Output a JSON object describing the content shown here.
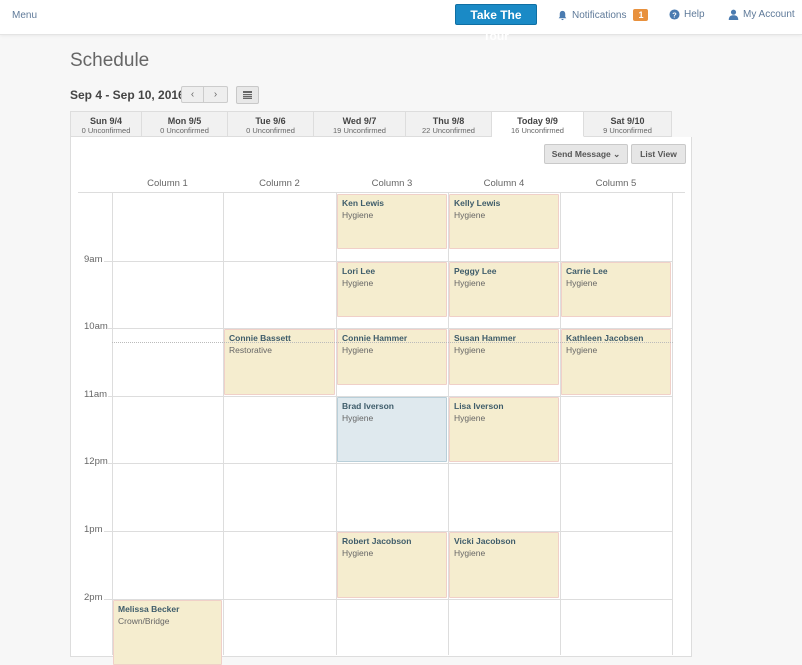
{
  "topbar": {
    "menu_label": "Menu",
    "tour_button": "Take The Tour",
    "notifications_label": "Notifications",
    "notifications_count": "1",
    "help_label": "Help",
    "account_label": "My Account",
    "colors": {
      "tour": "#1a8ac6",
      "badge": "#e8913d",
      "link": "#5f7a99"
    }
  },
  "page": {
    "title": "Schedule",
    "date_range": "Sep 4 - Sep 10, 2016",
    "prev_label": "‹",
    "next_label": "›"
  },
  "tabs": [
    {
      "day": "Sun 9/4",
      "unconfirmed": "0 Unconfirmed",
      "active": false
    },
    {
      "day": "Mon 9/5",
      "unconfirmed": "0 Unconfirmed",
      "active": false
    },
    {
      "day": "Tue 9/6",
      "unconfirmed": "0 Unconfirmed",
      "active": false
    },
    {
      "day": "Wed 9/7",
      "unconfirmed": "19 Unconfirmed",
      "active": false
    },
    {
      "day": "Thu 9/8",
      "unconfirmed": "22 Unconfirmed",
      "active": false
    },
    {
      "day": "Today 9/9",
      "unconfirmed": "16 Unconfirmed",
      "active": true
    },
    {
      "day": "Sat 9/10",
      "unconfirmed": "9 Unconfirmed",
      "active": false
    }
  ],
  "toolbar": {
    "send_message": "Send Message ⌄",
    "list_view": "List View"
  },
  "columns": [
    "Column 1",
    "Column 2",
    "Column 3",
    "Column 4",
    "Column 5"
  ],
  "times": [
    "9am",
    "10am",
    "11am",
    "12pm",
    "1pm",
    "2pm"
  ],
  "appointments": [
    {
      "name": "Ken Lewis",
      "type": "Hygiene",
      "column": 3,
      "start": 8.0,
      "end": 8.85,
      "color": "tan"
    },
    {
      "name": "Kelly Lewis",
      "type": "Hygiene",
      "column": 4,
      "start": 8.0,
      "end": 8.85,
      "color": "tan"
    },
    {
      "name": "Lori Lee",
      "type": "Hygiene",
      "column": 3,
      "start": 9.0,
      "end": 9.85,
      "color": "tan"
    },
    {
      "name": "Peggy Lee",
      "type": "Hygiene",
      "column": 4,
      "start": 9.0,
      "end": 9.85,
      "color": "tan"
    },
    {
      "name": "Carrie Lee",
      "type": "Hygiene",
      "column": 5,
      "start": 9.0,
      "end": 9.85,
      "color": "tan"
    },
    {
      "name": "Connie Bassett",
      "type": "Restorative",
      "column": 2,
      "start": 10.0,
      "end": 11.0,
      "color": "tan"
    },
    {
      "name": "Connie Hammer",
      "type": "Hygiene",
      "column": 3,
      "start": 10.0,
      "end": 10.85,
      "color": "tan"
    },
    {
      "name": "Susan Hammer",
      "type": "Hygiene",
      "column": 4,
      "start": 10.0,
      "end": 10.85,
      "color": "tan"
    },
    {
      "name": "Kathleen Jacobsen",
      "type": "Hygiene",
      "column": 5,
      "start": 10.0,
      "end": 11.0,
      "color": "tan"
    },
    {
      "name": "Brad Iverson",
      "type": "Hygiene",
      "column": 3,
      "start": 11.0,
      "end": 12.0,
      "color": "blue"
    },
    {
      "name": "Lisa Iverson",
      "type": "Hygiene",
      "column": 4,
      "start": 11.0,
      "end": 12.0,
      "color": "tan"
    },
    {
      "name": "Robert Jacobson",
      "type": "Hygiene",
      "column": 3,
      "start": 13.0,
      "end": 14.0,
      "color": "tan"
    },
    {
      "name": "Vicki Jacobson",
      "type": "Hygiene",
      "column": 4,
      "start": 13.0,
      "end": 14.0,
      "color": "tan"
    },
    {
      "name": "Melissa Becker",
      "type": "Crown/Bridge",
      "column": 1,
      "start": 14.0,
      "end": 15.0,
      "color": "tan"
    }
  ]
}
